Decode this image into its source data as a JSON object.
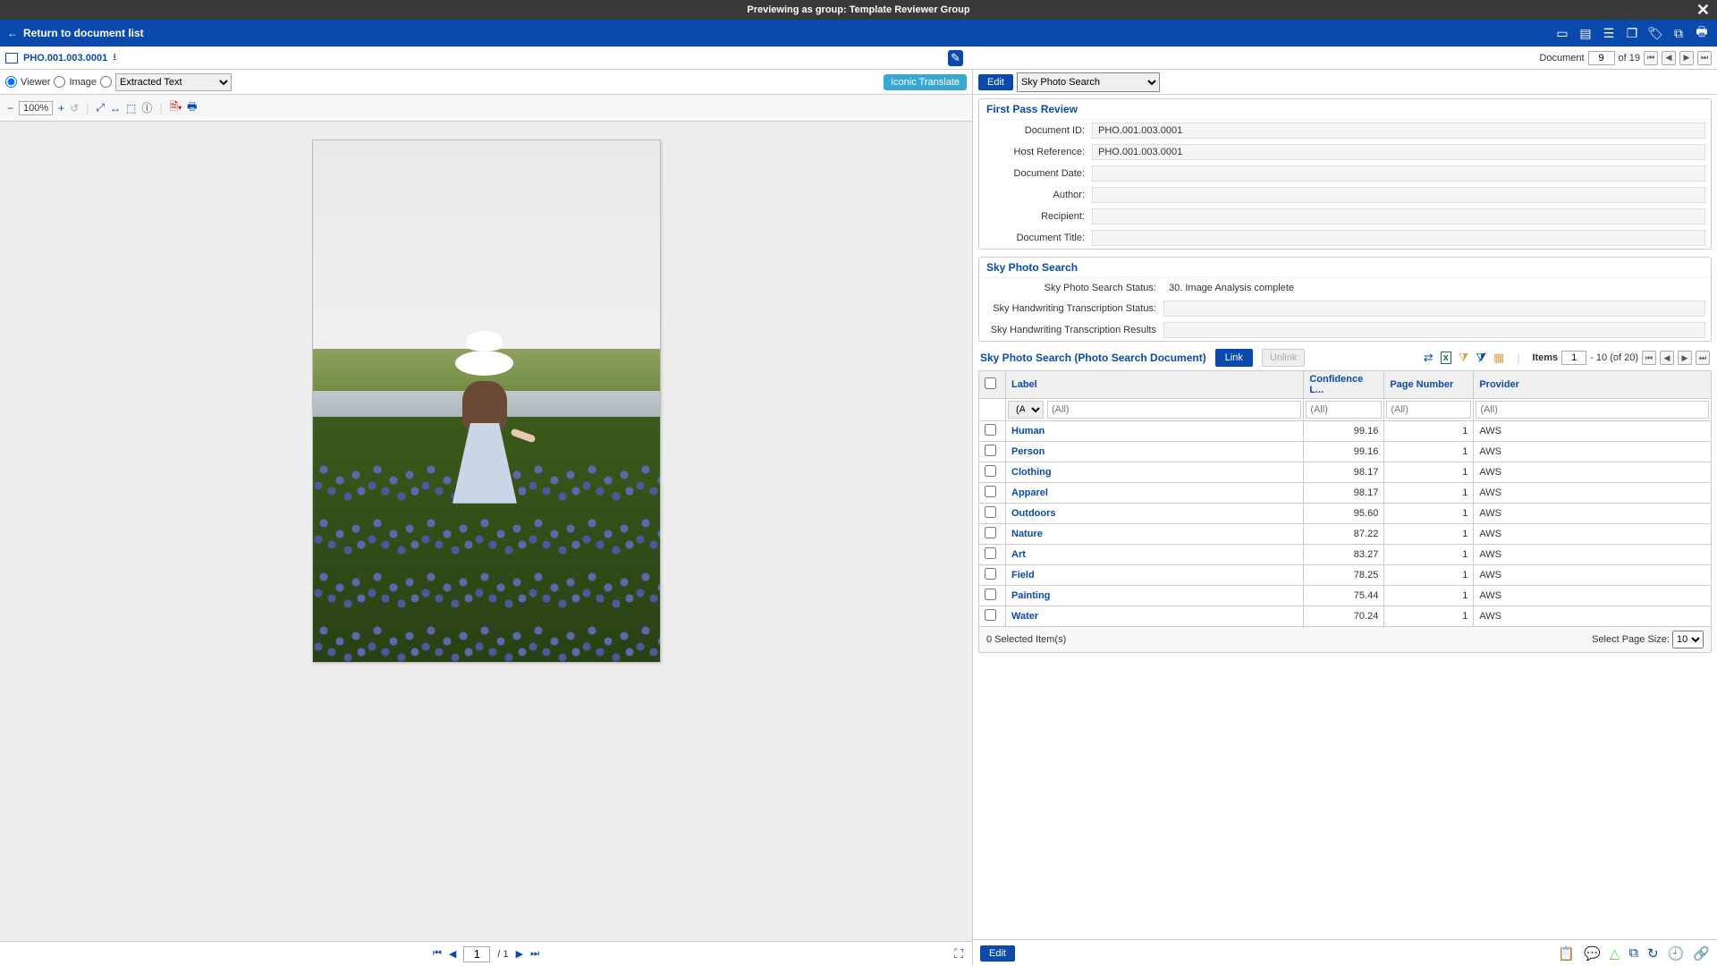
{
  "preview_bar": {
    "text": "Previewing as group: Template Reviewer Group"
  },
  "blue_bar": {
    "return_text": "Return to document list"
  },
  "sub_header": {
    "doc_id": "PHO.001.003.0001",
    "doc_label": "Document",
    "doc_current": "9",
    "doc_total": "of 19"
  },
  "viewer_toolbar": {
    "viewer": "Viewer",
    "image": "Image",
    "extract_select": "Extracted Text",
    "translate": "Iconic Translate"
  },
  "zoom": {
    "value": "100%"
  },
  "page_nav": {
    "current": "1",
    "total": "/ 1"
  },
  "right_bar": {
    "edit": "Edit",
    "select": "Sky Photo Search"
  },
  "first_pass": {
    "title": "First Pass Review",
    "doc_id_label": "Document ID:",
    "doc_id_value": "PHO.001.003.0001",
    "host_ref_label": "Host Reference:",
    "host_ref_value": "PHO.001.003.0001",
    "doc_date_label": "Document Date:",
    "author_label": "Author:",
    "recipient_label": "Recipient:",
    "doc_title_label": "Document Title:"
  },
  "sps_section": {
    "title": "Sky Photo Search",
    "status_label": "Sky Photo Search Status:",
    "status_value": "30. Image Analysis complete",
    "hand_status_label": "Sky Handwriting Transcription Status:",
    "hand_results_label": "Sky Handwriting Transcription Results"
  },
  "sps_table": {
    "title": "Sky Photo Search (Photo Search Document)",
    "link": "Link",
    "unlink": "Unlink",
    "items_label": "Items",
    "items_from": "1",
    "items_range": "- 10 (of 20)",
    "headers": {
      "label": "Label",
      "conf": "Confidence L...",
      "page": "Page Number",
      "provider": "Provider"
    },
    "filter_all": "(All)",
    "rows": [
      {
        "label": "Human",
        "conf": "99.16",
        "page": "1",
        "provider": "AWS"
      },
      {
        "label": "Person",
        "conf": "99.16",
        "page": "1",
        "provider": "AWS"
      },
      {
        "label": "Clothing",
        "conf": "98.17",
        "page": "1",
        "provider": "AWS"
      },
      {
        "label": "Apparel",
        "conf": "98.17",
        "page": "1",
        "provider": "AWS"
      },
      {
        "label": "Outdoors",
        "conf": "95.60",
        "page": "1",
        "provider": "AWS"
      },
      {
        "label": "Nature",
        "conf": "87.22",
        "page": "1",
        "provider": "AWS"
      },
      {
        "label": "Art",
        "conf": "83.27",
        "page": "1",
        "provider": "AWS"
      },
      {
        "label": "Field",
        "conf": "78.25",
        "page": "1",
        "provider": "AWS"
      },
      {
        "label": "Painting",
        "conf": "75.44",
        "page": "1",
        "provider": "AWS"
      },
      {
        "label": "Water",
        "conf": "70.24",
        "page": "1",
        "provider": "AWS"
      }
    ],
    "selected_text": "0  Selected Item(s)",
    "page_size_label": "Select Page Size:",
    "page_size_value": "10"
  },
  "bottom_edit": "Edit"
}
